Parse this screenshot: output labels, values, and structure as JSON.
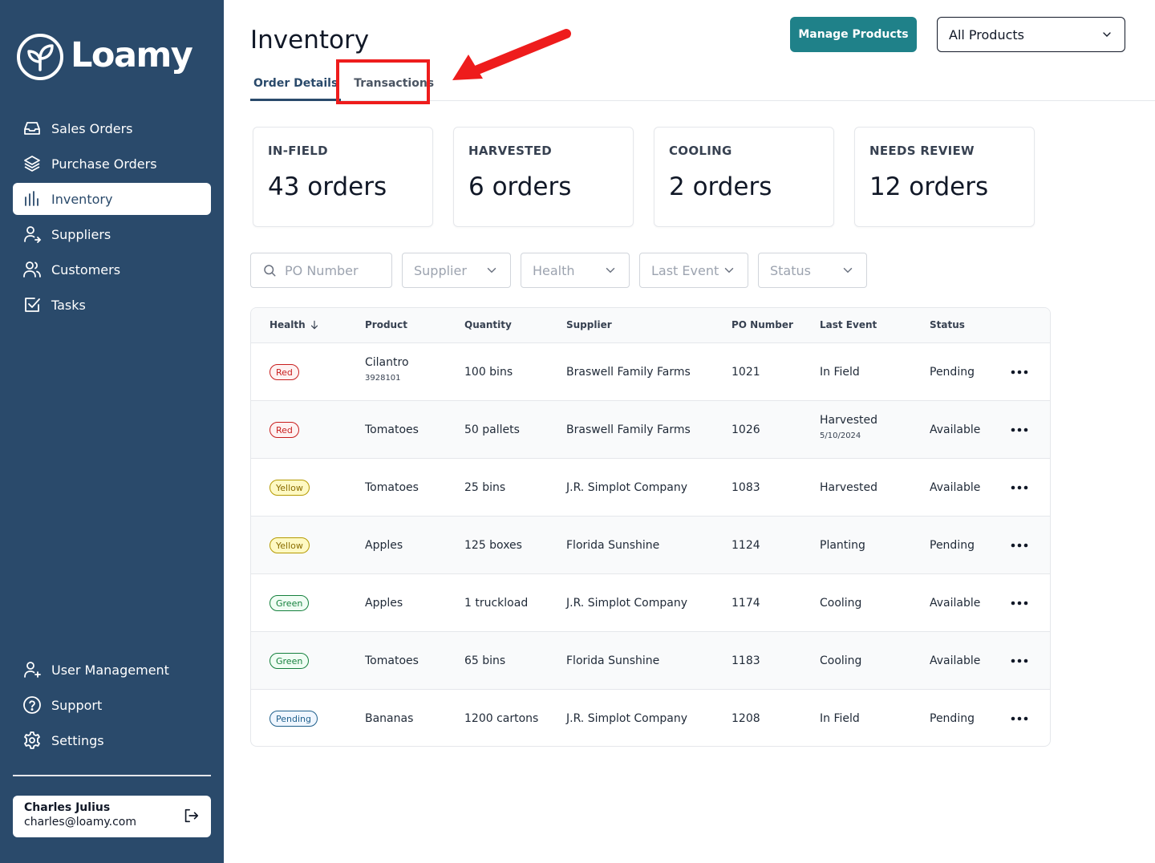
{
  "app": {
    "name": "Loamy"
  },
  "sidebar": {
    "items": [
      {
        "label": "Sales Orders",
        "icon": "inbox-icon"
      },
      {
        "label": "Purchase Orders",
        "icon": "layers-icon"
      },
      {
        "label": "Inventory",
        "icon": "bar-chart-icon",
        "active": true
      },
      {
        "label": "Suppliers",
        "icon": "user-arrow-icon"
      },
      {
        "label": "Customers",
        "icon": "users-icon"
      },
      {
        "label": "Tasks",
        "icon": "checkbox-icon"
      }
    ],
    "bottom_items": [
      {
        "label": "User Management",
        "icon": "user-plus-icon"
      },
      {
        "label": "Support",
        "icon": "help-circle-icon"
      },
      {
        "label": "Settings",
        "icon": "gear-icon"
      }
    ],
    "user": {
      "name": "Charles Julius",
      "email": "charles@loamy.com"
    }
  },
  "header": {
    "title": "Inventory",
    "manage_button": "Manage Products",
    "product_select": "All Products"
  },
  "tabs": [
    {
      "label": "Order Details",
      "active": true
    },
    {
      "label": "Transactions",
      "active": false
    }
  ],
  "stats": [
    {
      "label": "IN-FIELD",
      "value": "43 orders"
    },
    {
      "label": "HARVESTED",
      "value": "6 orders"
    },
    {
      "label": "COOLING",
      "value": "2 orders"
    },
    {
      "label": "NEEDS REVIEW",
      "value": "12 orders"
    }
  ],
  "filters": {
    "po_placeholder": "PO Number",
    "supplier": "Supplier",
    "health": "Health",
    "last_event": "Last Event",
    "status": "Status"
  },
  "table": {
    "columns": [
      "Health",
      "Product",
      "Quantity",
      "Supplier",
      "PO Number",
      "Last Event",
      "Status"
    ],
    "rows": [
      {
        "health": "Red",
        "health_class": "red",
        "product": "Cilantro",
        "product_sub": "3928101",
        "quantity": "100 bins",
        "supplier": "Braswell Family Farms",
        "po": "1021",
        "last_event": "In Field",
        "event_sub": "",
        "status": "Pending"
      },
      {
        "health": "Red",
        "health_class": "red",
        "product": "Tomatoes",
        "product_sub": "",
        "quantity": "50 pallets",
        "supplier": "Braswell Family Farms",
        "po": "1026",
        "last_event": "Harvested",
        "event_sub": "5/10/2024",
        "status": "Available"
      },
      {
        "health": "Yellow",
        "health_class": "yellow",
        "product": "Tomatoes",
        "product_sub": "",
        "quantity": "25 bins",
        "supplier": "J.R. Simplot Company",
        "po": "1083",
        "last_event": "Harvested",
        "event_sub": "",
        "status": "Available"
      },
      {
        "health": "Yellow",
        "health_class": "yellow",
        "product": "Apples",
        "product_sub": "",
        "quantity": "125 boxes",
        "supplier": "Florida Sunshine",
        "po": "1124",
        "last_event": "Planting",
        "event_sub": "",
        "status": "Pending"
      },
      {
        "health": "Green",
        "health_class": "green",
        "product": "Apples",
        "product_sub": "",
        "quantity": "1 truckload",
        "supplier": "J.R. Simplot Company",
        "po": "1174",
        "last_event": "Cooling",
        "event_sub": "",
        "status": "Available"
      },
      {
        "health": "Green",
        "health_class": "green",
        "product": "Tomatoes",
        "product_sub": "",
        "quantity": "65 bins",
        "supplier": "Florida Sunshine",
        "po": "1183",
        "last_event": "Cooling",
        "event_sub": "",
        "status": "Available"
      },
      {
        "health": "Pending",
        "health_class": "pending",
        "product": "Bananas",
        "product_sub": "",
        "quantity": "1200 cartons",
        "supplier": "J.R. Simplot Company",
        "po": "1208",
        "last_event": "In Field",
        "event_sub": "",
        "status": "Pending"
      }
    ]
  },
  "colors": {
    "sidebar": "#2a4a6b",
    "accent": "#1f8189",
    "annotation": "#ee1c1c"
  }
}
